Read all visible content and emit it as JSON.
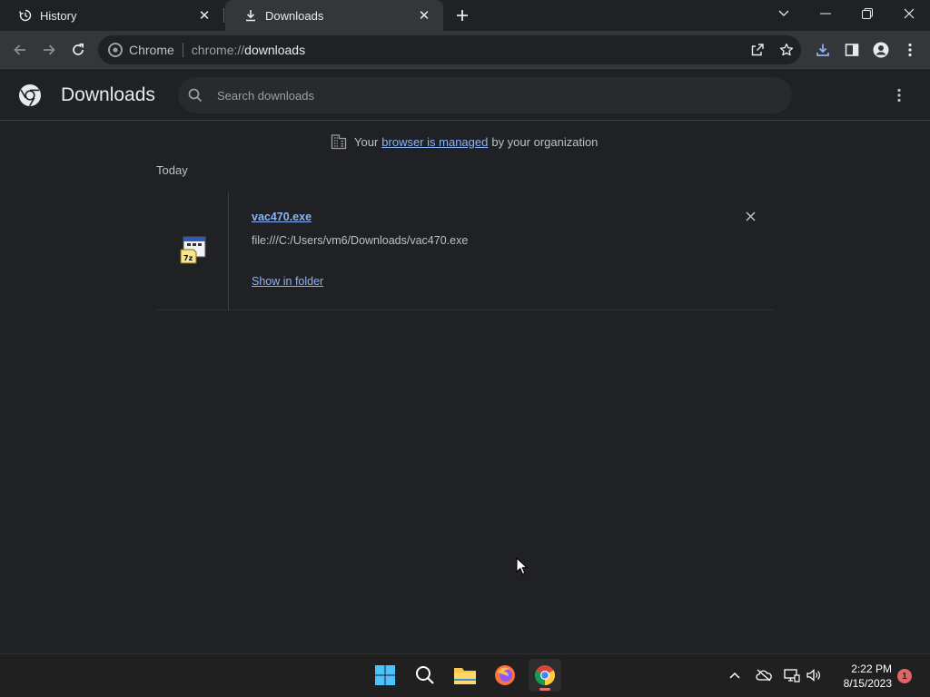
{
  "browser": {
    "tabs": [
      {
        "title": "History",
        "icon": "history-icon"
      },
      {
        "title": "Downloads",
        "icon": "download-icon"
      }
    ],
    "omnibox": {
      "chip": "Chrome",
      "url_scheme": "chrome://",
      "url_host": "downloads"
    }
  },
  "downloads_page": {
    "title": "Downloads",
    "search_placeholder": "Search downloads",
    "managed_notice": {
      "prefix": "Your",
      "link": "browser is managed",
      "suffix": "by your organization"
    },
    "sections": [
      {
        "date": "Today",
        "items": [
          {
            "file_name": "vac470.exe",
            "url": "file:///C:/Users/vm6/Downloads/vac470.exe",
            "action": "Show in folder",
            "icon": "7z-installer-icon"
          }
        ]
      }
    ]
  },
  "taskbar": {
    "apps": [
      "windows-start-icon",
      "search-icon",
      "file-explorer-icon",
      "firefox-icon",
      "chrome-icon"
    ],
    "active_app": "chrome-icon",
    "clock_time": "2:22 PM",
    "clock_date": "8/15/2023",
    "notification_count": "1"
  },
  "colors": {
    "page_bg": "#202124",
    "toolbar_bg": "#35363a",
    "link": "#8ab4f8",
    "text_secondary": "#bdc1c6",
    "notification_badge": "#e06666"
  }
}
